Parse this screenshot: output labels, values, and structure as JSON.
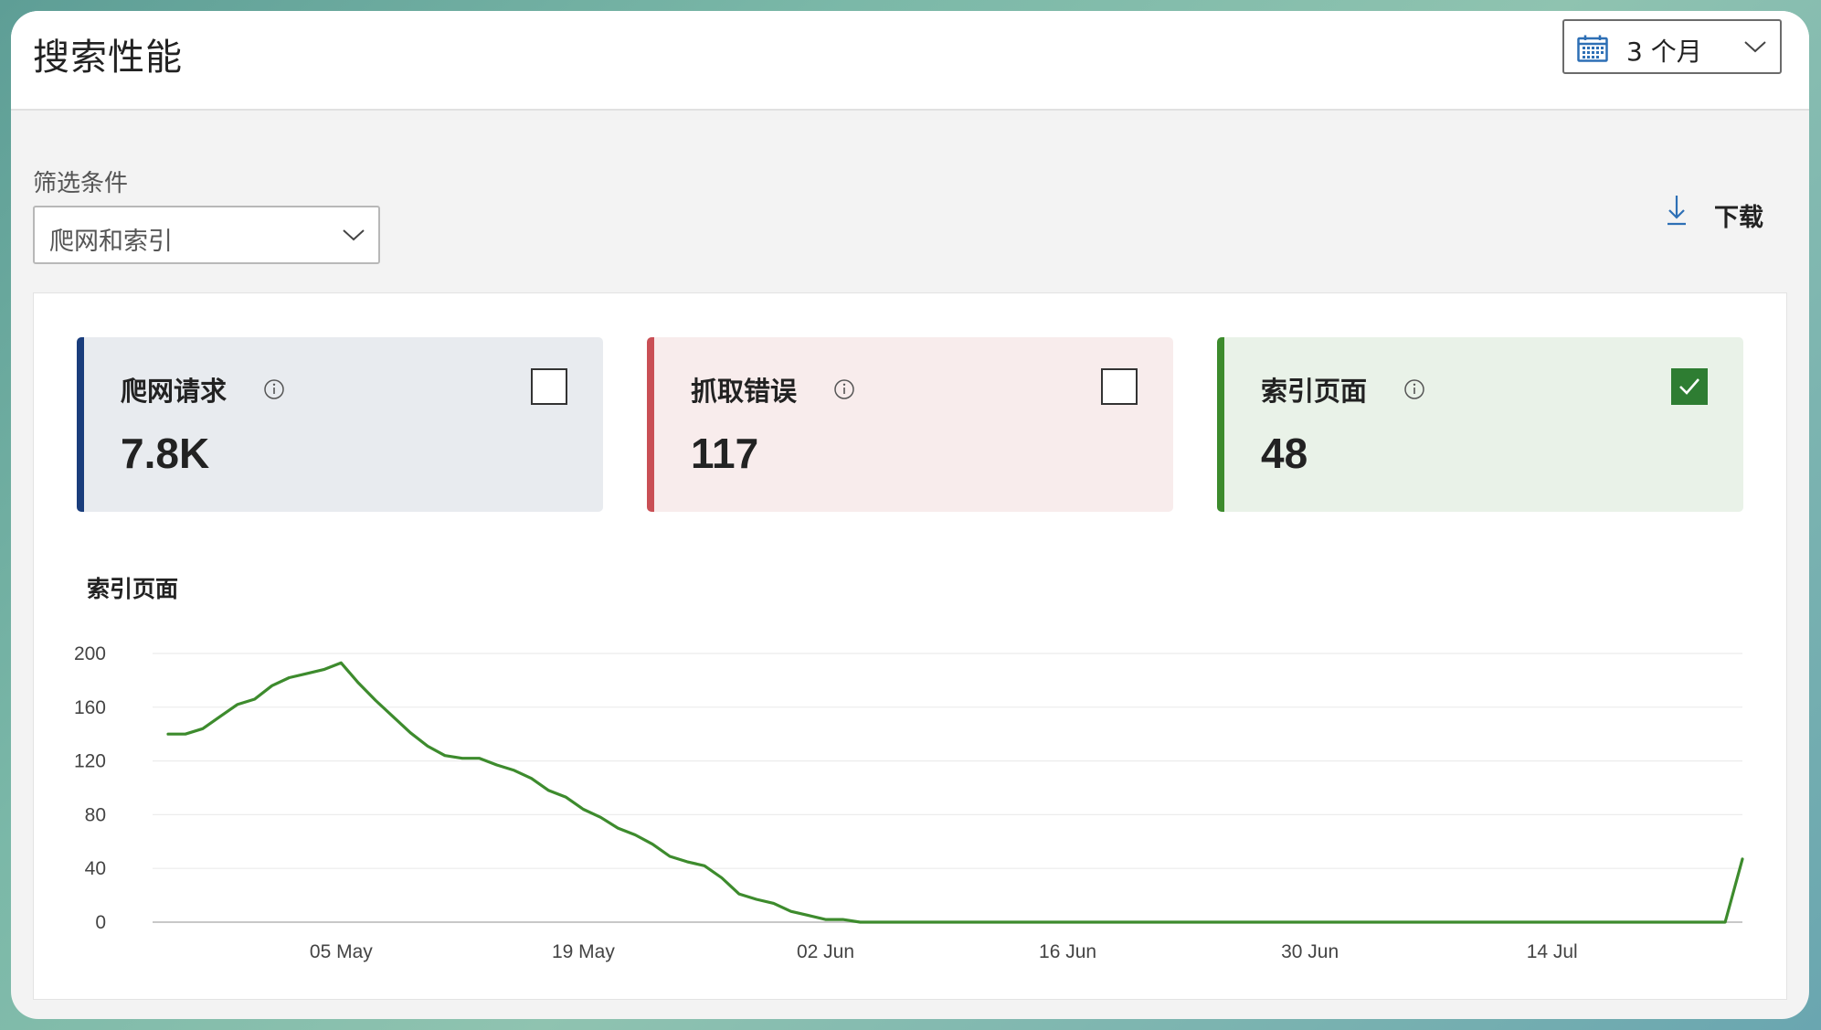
{
  "header": {
    "title": "搜索性能",
    "period_select": {
      "value": "3 个月",
      "icon": "calendar-icon"
    }
  },
  "filter": {
    "label": "筛选条件",
    "value": "爬网和索引"
  },
  "download": {
    "label": "下载",
    "icon": "download-icon"
  },
  "cards": [
    {
      "title": "爬网请求",
      "value": "7.8K",
      "checked": false,
      "accent": "#1a3d7c",
      "bg": "#e8ebef"
    },
    {
      "title": "抓取错误",
      "value": "117",
      "checked": false,
      "accent": "#c94f55",
      "bg": "#f8ecec"
    },
    {
      "title": "索引页面",
      "value": "48",
      "checked": true,
      "accent": "#3d8b2d",
      "bg": "#e9f2e8"
    }
  ],
  "chart": {
    "title": "索引页面"
  },
  "chart_data": {
    "type": "line",
    "title": "索引页面",
    "xlabel": "",
    "ylabel": "",
    "ylim": [
      0,
      200
    ],
    "yticks": [
      0,
      40,
      80,
      120,
      160,
      200
    ],
    "xticks": [
      "05 May",
      "19 May",
      "02 Jun",
      "16 Jun",
      "30 Jun",
      "14 Jul"
    ],
    "grid": true,
    "legend": "none",
    "color": "#3d8b2d",
    "series": [
      {
        "x": [
          "25 Apr",
          "26 Apr",
          "27 Apr",
          "28 Apr",
          "29 Apr",
          "30 Apr",
          "01 May",
          "02 May",
          "03 May",
          "04 May",
          "05 May",
          "06 May",
          "07 May",
          "08 May",
          "09 May",
          "10 May",
          "11 May",
          "12 May",
          "13 May",
          "14 May",
          "15 May",
          "16 May",
          "17 May",
          "18 May",
          "19 May",
          "20 May",
          "21 May",
          "22 May",
          "23 May",
          "24 May",
          "25 May",
          "26 May",
          "27 May",
          "28 May",
          "29 May",
          "30 May",
          "31 May",
          "01 Jun",
          "02 Jun",
          "03 Jun",
          "04 Jun",
          "24 Jul",
          "25 Jul"
        ],
        "values": [
          140,
          140,
          144,
          153,
          162,
          166,
          176,
          182,
          185,
          188,
          193,
          178,
          165,
          153,
          141,
          131,
          124,
          122,
          122,
          117,
          113,
          107,
          98,
          93,
          84,
          78,
          70,
          65,
          58,
          49,
          45,
          42,
          33,
          21,
          17,
          14,
          8,
          5,
          2,
          2,
          0,
          0,
          47
        ]
      }
    ]
  }
}
